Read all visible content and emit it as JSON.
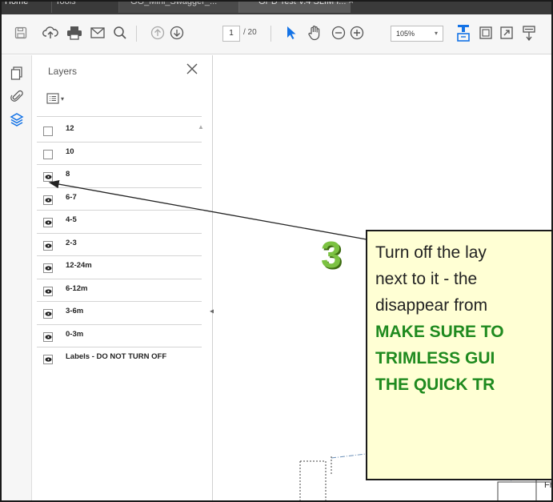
{
  "tabs": [
    {
      "label": "Home"
    },
    {
      "label": "Tools"
    },
    {
      "label": "GG_Mini_Swagger_..."
    },
    {
      "label": "GPD Test V.4 SLIM I... ×"
    }
  ],
  "toolbar": {
    "page_current": "1",
    "page_total": "/ 20",
    "zoom": "105%"
  },
  "layers_panel": {
    "title": "Layers",
    "layers": [
      {
        "label": "12",
        "visible": false
      },
      {
        "label": "10",
        "visible": false
      },
      {
        "label": "8",
        "visible": true
      },
      {
        "label": "6-7",
        "visible": true
      },
      {
        "label": "4-5",
        "visible": true
      },
      {
        "label": "2-3",
        "visible": true
      },
      {
        "label": "12-24m",
        "visible": true
      },
      {
        "label": "6-12m",
        "visible": true
      },
      {
        "label": "3-6m",
        "visible": true
      },
      {
        "label": "0-3m",
        "visible": true
      },
      {
        "label": "Labels - DO NOT TURN OFF",
        "visible": true
      }
    ]
  },
  "annotation": {
    "step": "3",
    "lines": [
      "Turn off the lay",
      "next to it - the",
      "disappear from"
    ],
    "green_lines": [
      "MAKE SURE TO",
      "TRIMLESS GUI",
      "THE QUICK TR"
    ],
    "green_color": "#1f8a1f",
    "step_color": "#7cc242",
    "callout_bg": "#ffffd4"
  },
  "canvas": {
    "fragment_label": "Fr"
  }
}
